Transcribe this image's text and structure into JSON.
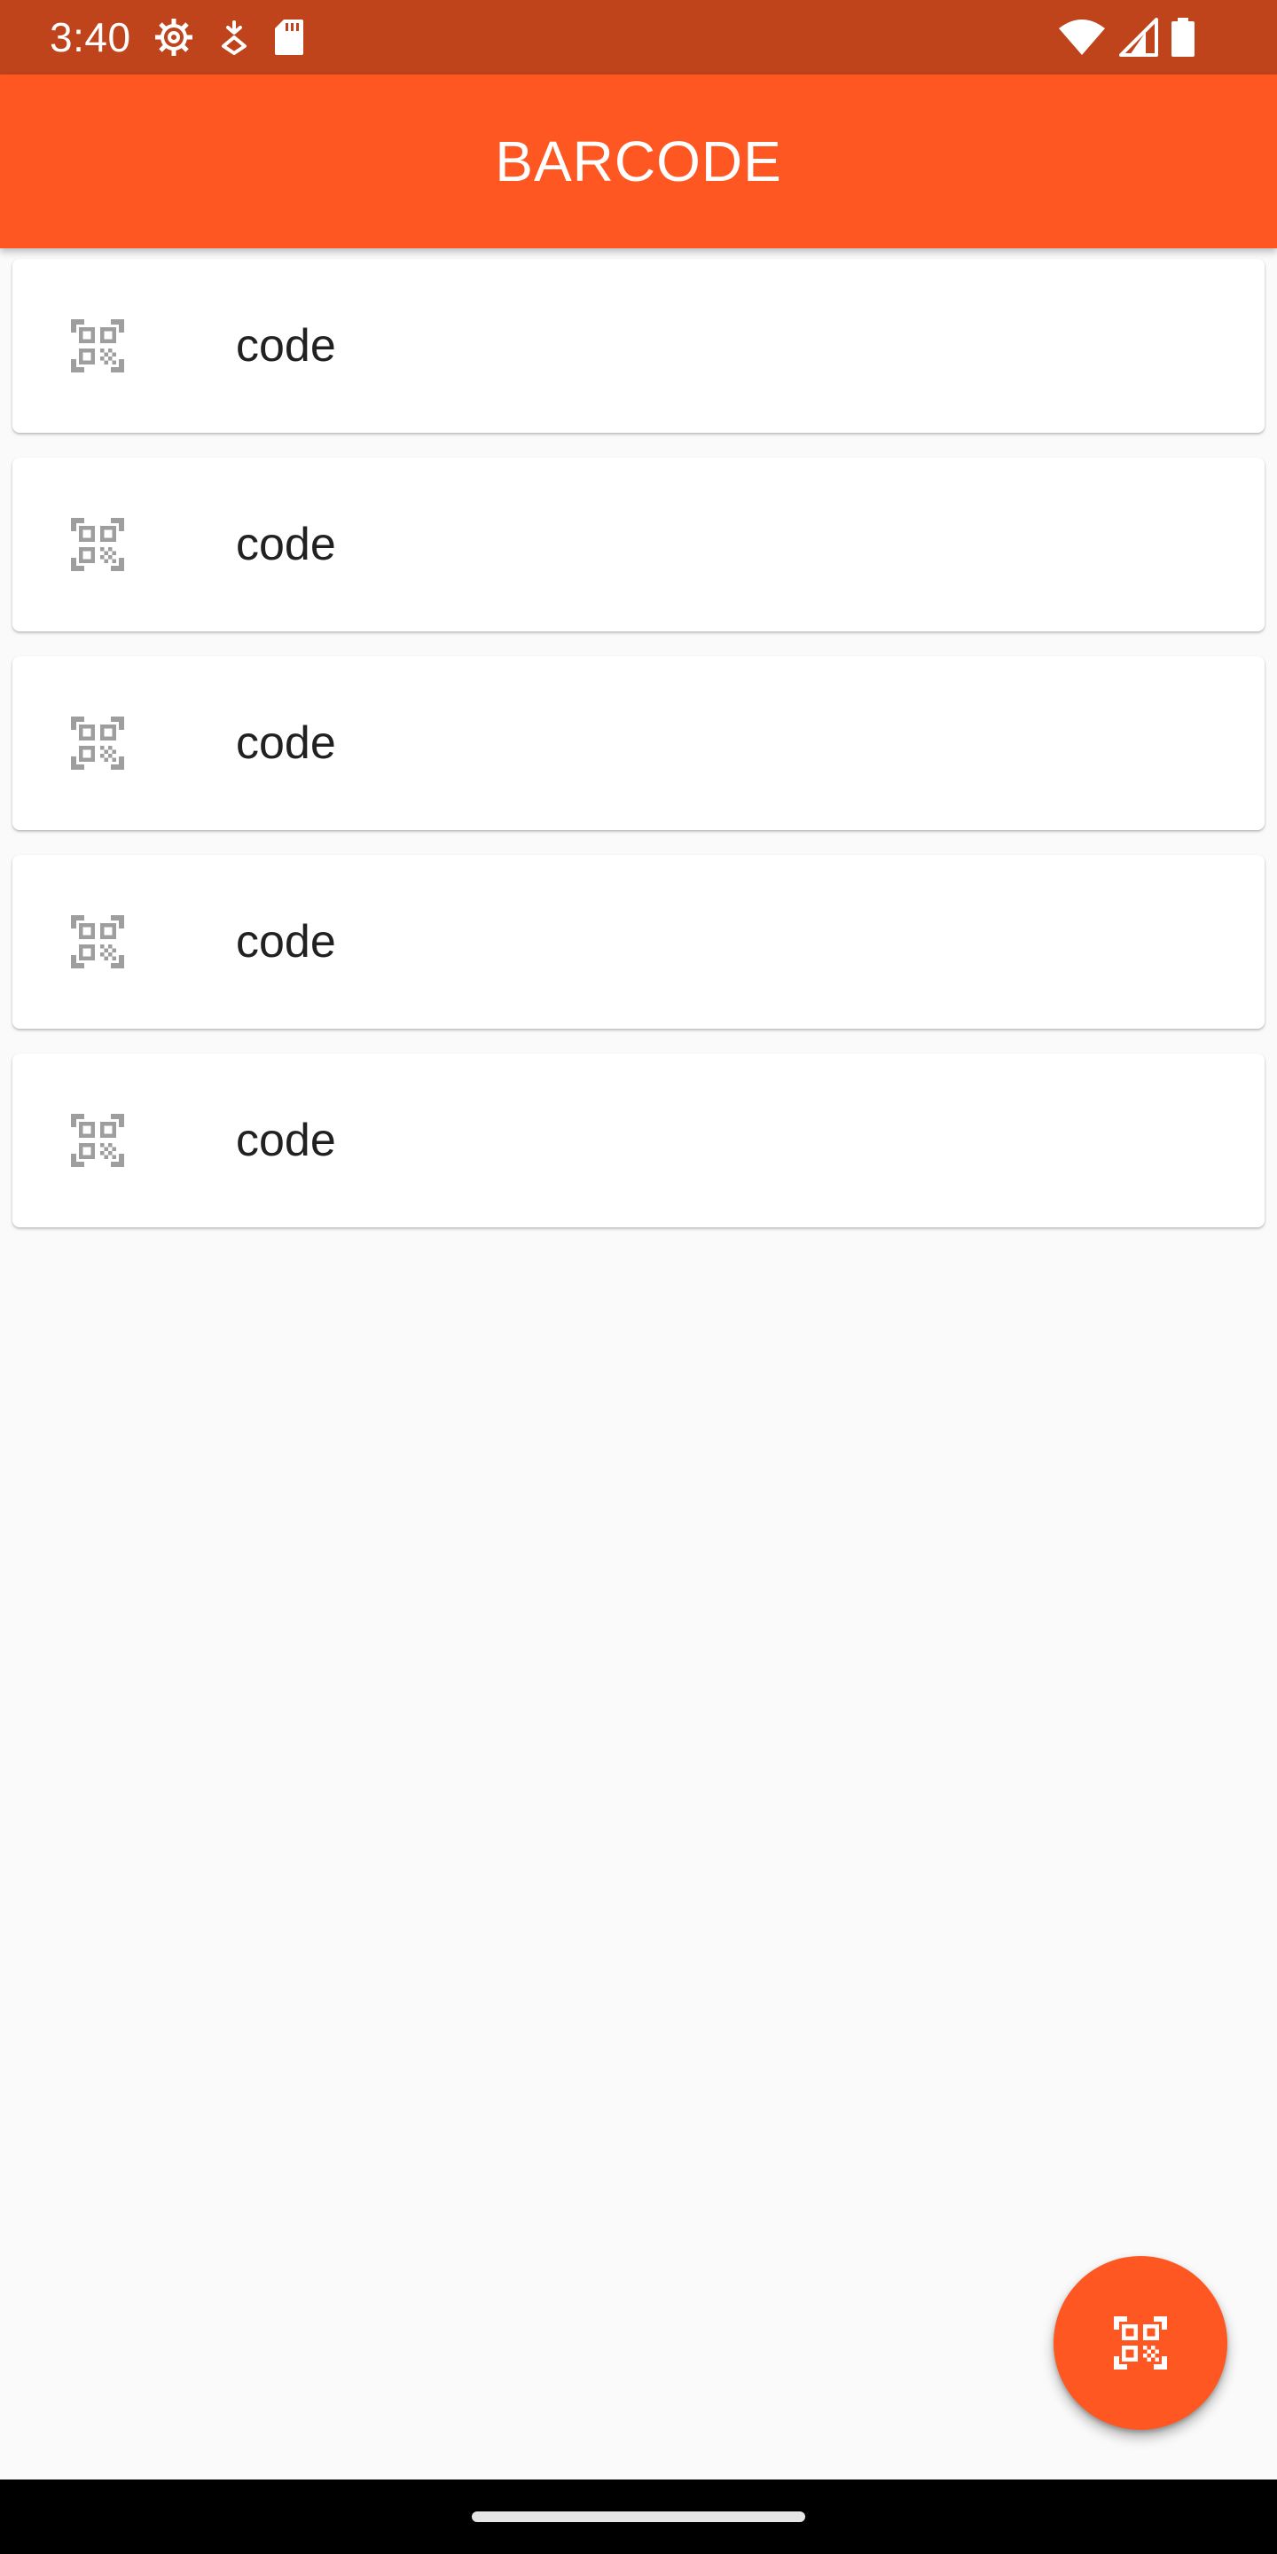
{
  "status_bar": {
    "time": "3:40",
    "left_icons": [
      "settings-icon",
      "download-icon",
      "sd-card-icon"
    ],
    "right_icons": [
      "wifi-icon",
      "signal-icon",
      "battery-icon"
    ],
    "background": "#bf441c"
  },
  "app_bar": {
    "title": "BARCODE",
    "background": "#ff5722"
  },
  "list": {
    "item_icon": "qr-code-scanner-icon",
    "items": [
      {
        "label": "code"
      },
      {
        "label": "code"
      },
      {
        "label": "code"
      },
      {
        "label": "code"
      },
      {
        "label": "code"
      }
    ]
  },
  "fab": {
    "icon": "qr-code-scanner-icon",
    "background": "#ff5722"
  }
}
